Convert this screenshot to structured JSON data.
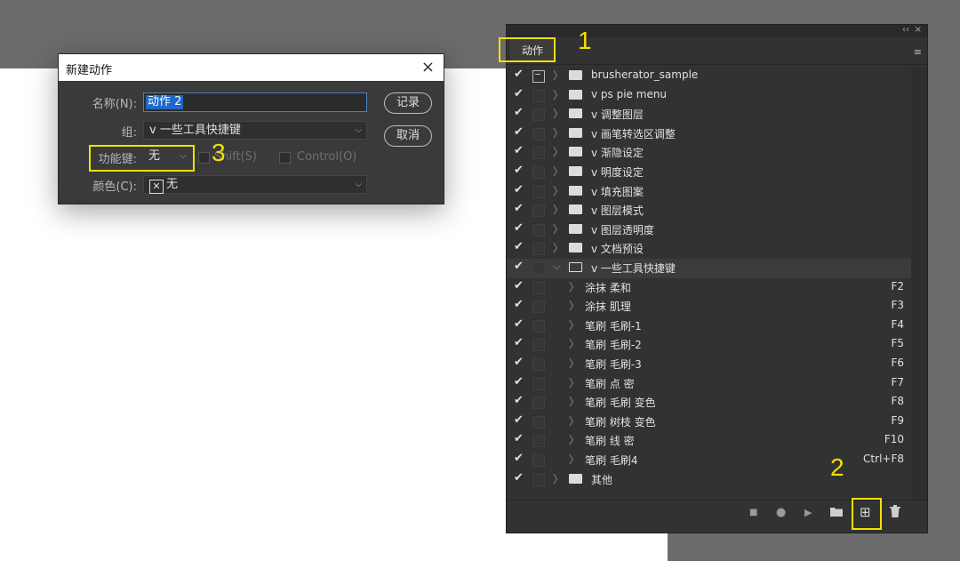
{
  "dialog": {
    "title": "新建动作",
    "close_icon": "×",
    "name_label": "名称(N):",
    "name_value": "动作 2",
    "group_label": "组:",
    "group_value": "v 一些工具快捷键",
    "fkey_label": "功能键:",
    "fkey_value": "无",
    "shift_label": "Shift(S)",
    "control_label": "Control(O)",
    "color_label": "颜色(C):",
    "color_value": "无",
    "record_button": "记录",
    "cancel_button": "取消"
  },
  "annotations": [
    "1",
    "2",
    "3"
  ],
  "panel": {
    "tab_label": "动作",
    "collapse_icon": "‹‹",
    "close_icon": "×",
    "menu_icon": "≡",
    "rows": [
      {
        "type": "set",
        "label": "brusherator_sample",
        "dialog": true
      },
      {
        "type": "set",
        "label": "v ps pie menu"
      },
      {
        "type": "set",
        "label": "v 调整图层"
      },
      {
        "type": "set",
        "label": "v 画笔转选区调整"
      },
      {
        "type": "set",
        "label": "v 渐隐设定"
      },
      {
        "type": "set",
        "label": "v 明度设定"
      },
      {
        "type": "set",
        "label": "v 填充图案"
      },
      {
        "type": "set",
        "label": "v 图层模式"
      },
      {
        "type": "set",
        "label": "v 图层透明度"
      },
      {
        "type": "set",
        "label": "v 文档预设"
      },
      {
        "type": "set-open",
        "label": "v 一些工具快捷键"
      },
      {
        "type": "action",
        "label": "涂抹 柔和",
        "key": "F2"
      },
      {
        "type": "action",
        "label": "涂抹 肌理",
        "key": "F3"
      },
      {
        "type": "action",
        "label": "笔刷 毛刷-1",
        "key": "F4"
      },
      {
        "type": "action",
        "label": "笔刷 毛刷-2",
        "key": "F5"
      },
      {
        "type": "action",
        "label": "笔刷 毛刷-3",
        "key": "F6"
      },
      {
        "type": "action",
        "label": "笔刷 点 密",
        "key": "F7"
      },
      {
        "type": "action",
        "label": "笔刷 毛刷 变色",
        "key": "F8"
      },
      {
        "type": "action",
        "label": "笔刷 树枝 变色",
        "key": "F9"
      },
      {
        "type": "action",
        "label": "笔刷 线 密",
        "key": "F10"
      },
      {
        "type": "action",
        "label": "笔刷 毛刷4",
        "key": "Ctrl+F8"
      },
      {
        "type": "set",
        "label": "其他"
      }
    ],
    "bottom_icons": {
      "stop": "■",
      "record": "●",
      "play": "▶",
      "new_set": "folder",
      "new_action": "⊞",
      "delete": "trash"
    }
  }
}
